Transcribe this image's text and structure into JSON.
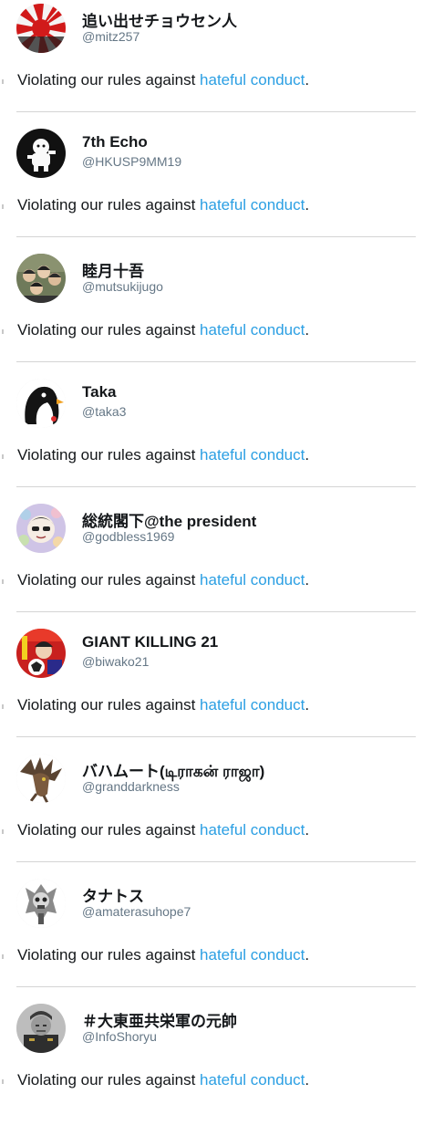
{
  "notice": {
    "prefix": "Violating our rules against ",
    "link": "hateful conduct",
    "suffix": "."
  },
  "colors": {
    "link": "#2b9fe3",
    "handle": "#657786",
    "divider": "#d4d4d4"
  },
  "accounts": [
    {
      "name": "追い出せチョウセン人",
      "handle": "@mitz257",
      "avatar_icon": "rising-sun-flag-avatar"
    },
    {
      "name": "7th Echo",
      "handle": "@HKUSP9MM19",
      "avatar_icon": "cartoon-figure-avatar"
    },
    {
      "name": "睦月十吾",
      "handle": "@mutsukijugo",
      "avatar_icon": "group-photo-avatar"
    },
    {
      "name": "Taka",
      "handle": "@taka3",
      "avatar_icon": "penguin-avatar"
    },
    {
      "name": "総統閣下@the president",
      "handle": "@godbless1969",
      "avatar_icon": "illustrated-face-avatar"
    },
    {
      "name": "GIANT KILLING 21",
      "handle": "@biwako21",
      "avatar_icon": "manga-cover-avatar"
    },
    {
      "name": "バハムート(டிராகன் ராஜா)",
      "handle": "@granddarkness",
      "avatar_icon": "dragon-avatar"
    },
    {
      "name": "タナトス",
      "handle": "@amaterasuhope7",
      "avatar_icon": "skull-emblem-avatar"
    },
    {
      "name": "＃大東亜共栄軍の元帥",
      "handle": "@InfoShoryu",
      "avatar_icon": "military-portrait-avatar"
    }
  ]
}
